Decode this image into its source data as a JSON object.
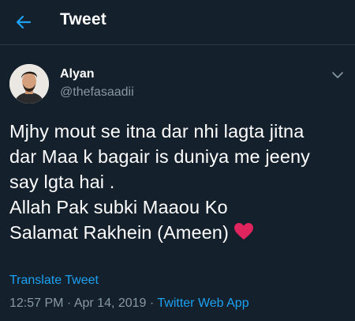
{
  "header": {
    "title": "Tweet",
    "back_icon": "back-arrow-icon"
  },
  "author": {
    "display_name": "Alyan",
    "handle": "@thefasaadii"
  },
  "tweet": {
    "lines": [
      "Mjhy mout se itna dar nhi lagta jitna",
      "dar Maa k bagair is duniya me jeeny",
      "say lgta hai .",
      "Allah Pak subki Maaou Ko",
      "Salamat Rakhein (Ameen)"
    ],
    "emoji": "red-heart-icon"
  },
  "translate_label": "Translate Tweet",
  "meta": {
    "time": "12:57 PM",
    "separator": " · ",
    "date": "Apr 14, 2019",
    "source": "Twitter Web App"
  },
  "colors": {
    "background": "#14202b",
    "accent": "#1da1f2",
    "secondary_text": "#8899a6",
    "heart": "#e0245e"
  }
}
